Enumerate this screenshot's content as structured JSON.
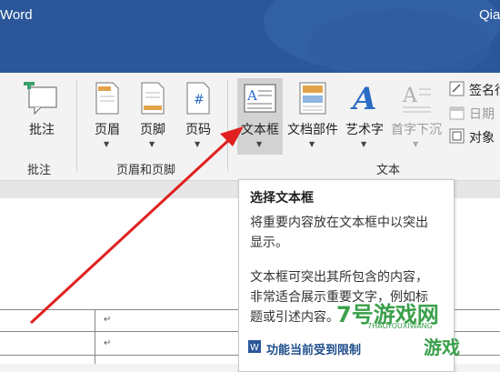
{
  "titlebar": {
    "app_title": "Word",
    "user_name": "Qia"
  },
  "ribbon": {
    "groups": [
      {
        "label": "批注"
      },
      {
        "label": "页眉和页脚"
      },
      {
        "label": "文本"
      }
    ],
    "buttons": {
      "comment": "批注",
      "header": "页眉",
      "footer": "页脚",
      "page_number": "页码",
      "text_box": "文本框",
      "quick_parts": "文档部件",
      "wordart": "艺术字",
      "drop_cap": "首字下沉",
      "signature_line": "签名行",
      "date_time": "日期",
      "object": "对象"
    }
  },
  "tooltip": {
    "title": "选择文本框",
    "line1": "将重要内容放在文本框中以突出",
    "line2": "显示。",
    "line3": "文本框可突出其所包含的内容，",
    "line4": "非常适合展示重要文字，例如标",
    "line5": "题或引述内容。",
    "link": "功能当前受到限制"
  },
  "document": {
    "paragraph_mark": "↵"
  },
  "watermark": {
    "brand": "7号游戏网",
    "url": "7HAOYOUXIWANG",
    "slogan": "游戏"
  },
  "colors": {
    "titlebar": "#2b579a",
    "arrow": "#e02020",
    "wordart": "#2b6cc4"
  }
}
